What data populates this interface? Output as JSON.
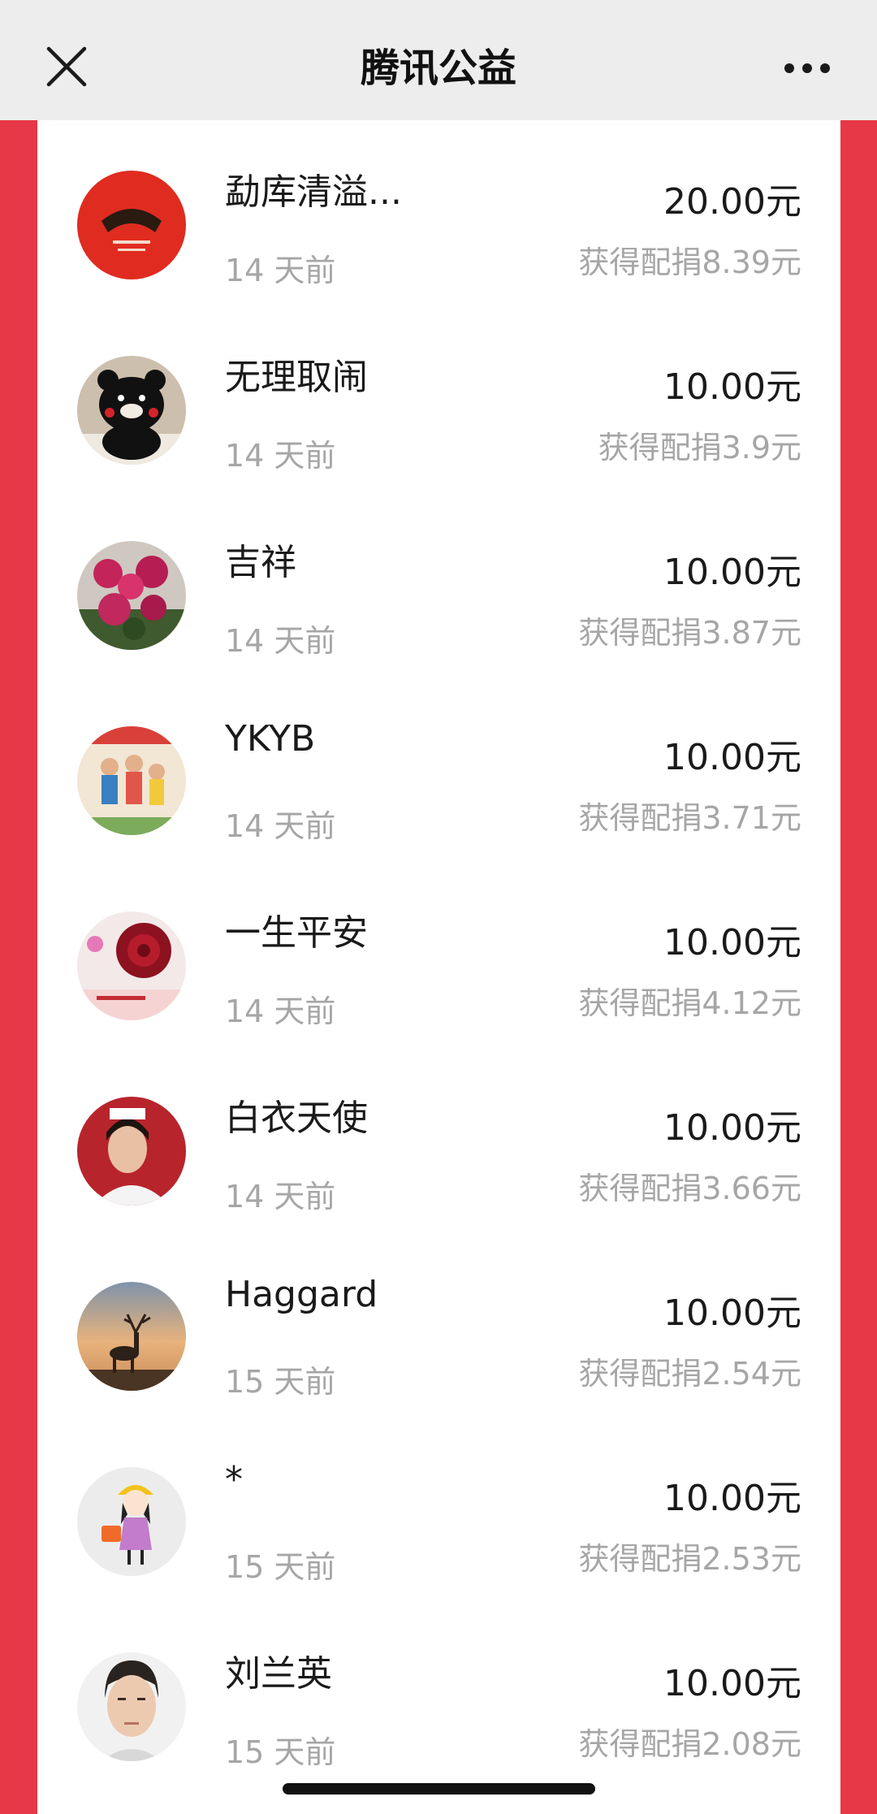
{
  "header": {
    "title": "腾讯公益",
    "close_icon": "close-icon",
    "more_icon": "more-icon"
  },
  "colors": {
    "accent_red": "#e63846",
    "header_bg": "#ededed"
  },
  "donations": [
    {
      "name": "勐库清溢...",
      "time": "14 天前",
      "amount": "20.00元",
      "match": "获得配捐8.39元",
      "avatar": "red-fan-logo-avatar"
    },
    {
      "name": "无理取闹",
      "time": "14 天前",
      "amount": "10.00元",
      "match": "获得配捐3.9元",
      "avatar": "black-bear-avatar"
    },
    {
      "name": "吉祥",
      "time": "14 天前",
      "amount": "10.00元",
      "match": "获得配捐3.87元",
      "avatar": "pink-peony-avatar"
    },
    {
      "name": "YKYB",
      "time": "14 天前",
      "amount": "10.00元",
      "match": "获得配捐3.71元",
      "avatar": "family-poster-avatar"
    },
    {
      "name": "一生平安",
      "time": "14 天前",
      "amount": "10.00元",
      "match": "获得配捐4.12元",
      "avatar": "red-rose-avatar"
    },
    {
      "name": "白衣天使",
      "time": "14 天前",
      "amount": "10.00元",
      "match": "获得配捐3.66元",
      "avatar": "nurse-photo-avatar"
    },
    {
      "name": "Haggard",
      "time": "15 天前",
      "amount": "10.00元",
      "match": "获得配捐2.54元",
      "avatar": "deer-sunset-avatar"
    },
    {
      "name": "*",
      "time": "15 天前",
      "amount": "10.00元",
      "match": "获得配捐2.53元",
      "avatar": "cartoon-girl-avatar"
    },
    {
      "name": "刘兰英",
      "time": "15 天前",
      "amount": "10.00元",
      "match": "获得配捐2.08元",
      "avatar": "woman-portrait-avatar"
    }
  ]
}
